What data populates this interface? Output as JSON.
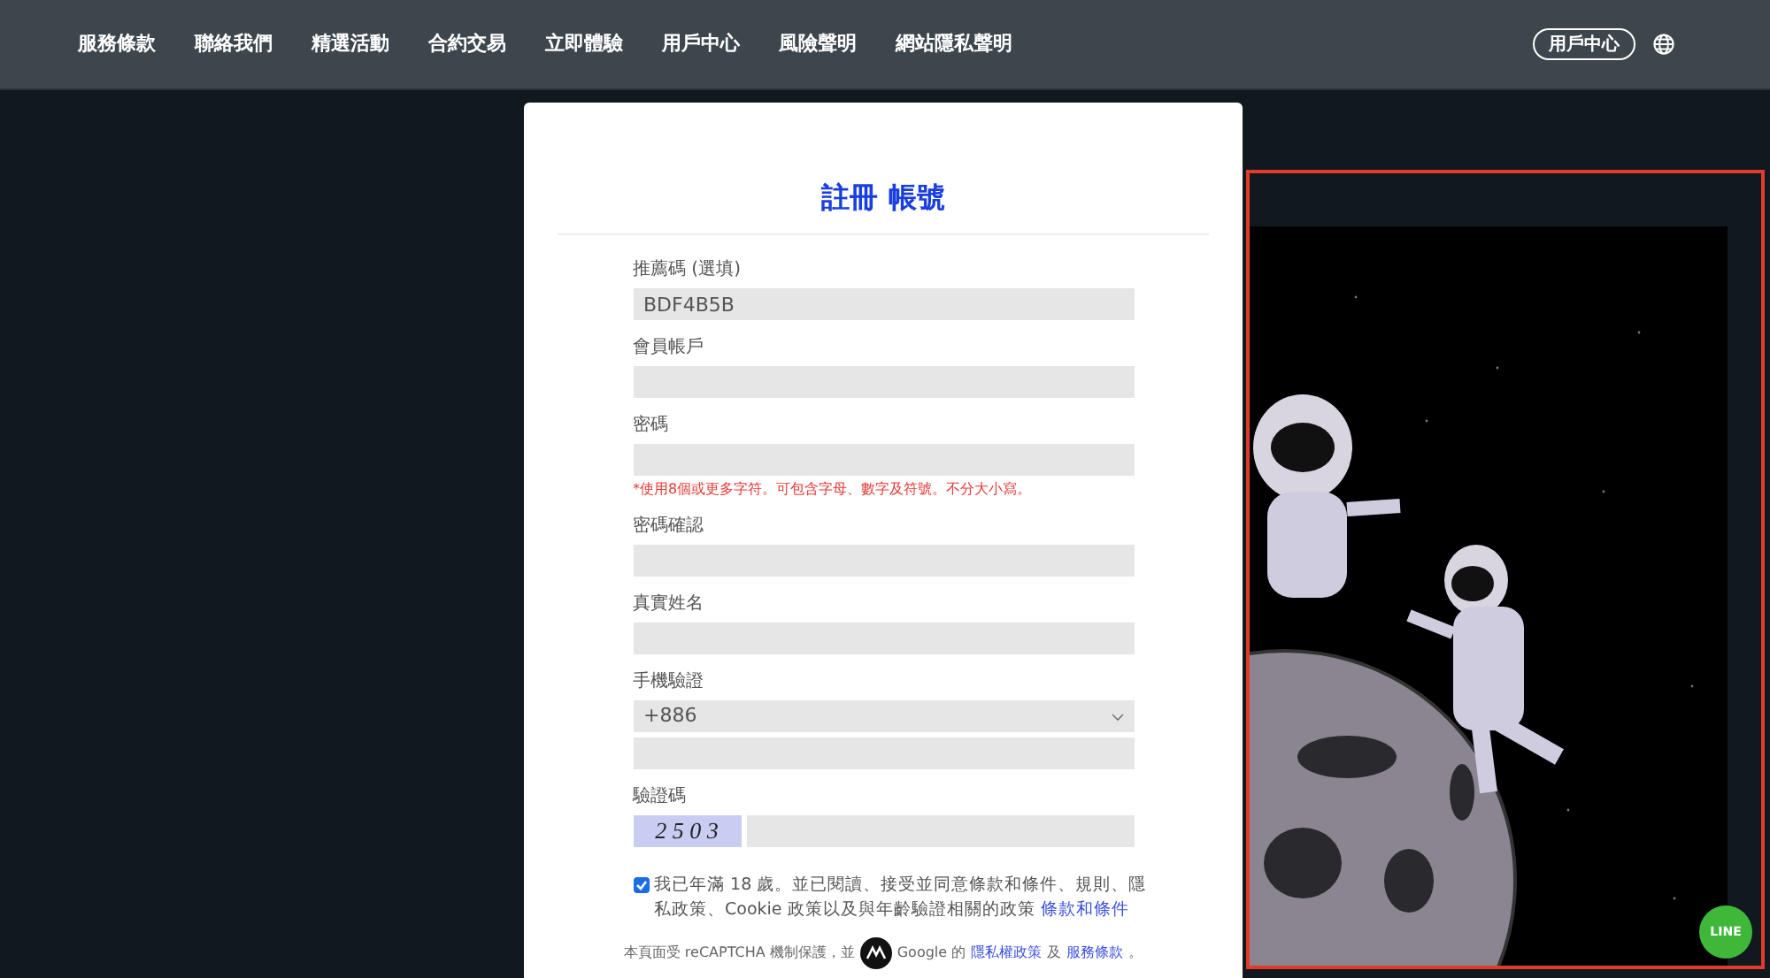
{
  "nav": {
    "links": [
      {
        "label": "服務條款"
      },
      {
        "label": "聯絡我們"
      },
      {
        "label": "精選活動"
      },
      {
        "label": "合約交易"
      },
      {
        "label": "立即體驗"
      },
      {
        "label": "用戶中心"
      },
      {
        "label": "風險聲明"
      },
      {
        "label": "網站隱私聲明"
      }
    ],
    "user_button": "用戶中心"
  },
  "form": {
    "title": "註冊 帳號",
    "fields": [
      {
        "kind": "input",
        "label": "推薦碼 (選填)",
        "value": "BDF4B5B"
      },
      {
        "kind": "input",
        "label": "會員帳戶"
      },
      {
        "kind": "input",
        "label": "密碼",
        "hint": "*使用8個或更多字符。可包含字母、數字及符號。不分大小寫。"
      },
      {
        "kind": "input",
        "label": "密碼確認"
      },
      {
        "kind": "input",
        "label": "真實姓名"
      },
      {
        "kind": "phone",
        "label": "手機驗證",
        "country_code": "+886"
      },
      {
        "kind": "captcha",
        "label": "驗證碼",
        "captcha": "2 5 0 3"
      }
    ],
    "agreement": {
      "checked": true,
      "text": "我已年滿 18 歲。並已閱讀、接受並同意條款和條件、規則、隱私政策、Cookie 政策以及與年齡驗證相關的政策",
      "link": "條款和條件"
    },
    "recaptcha": {
      "before": "本頁面受 reCAPTCHA 機制保護，並",
      "after": "Google 的",
      "privacy_link": "隱私權政策",
      "joiner": "及",
      "terms_link": "服務條款",
      "end": "。"
    }
  },
  "line_button": "LINE"
}
